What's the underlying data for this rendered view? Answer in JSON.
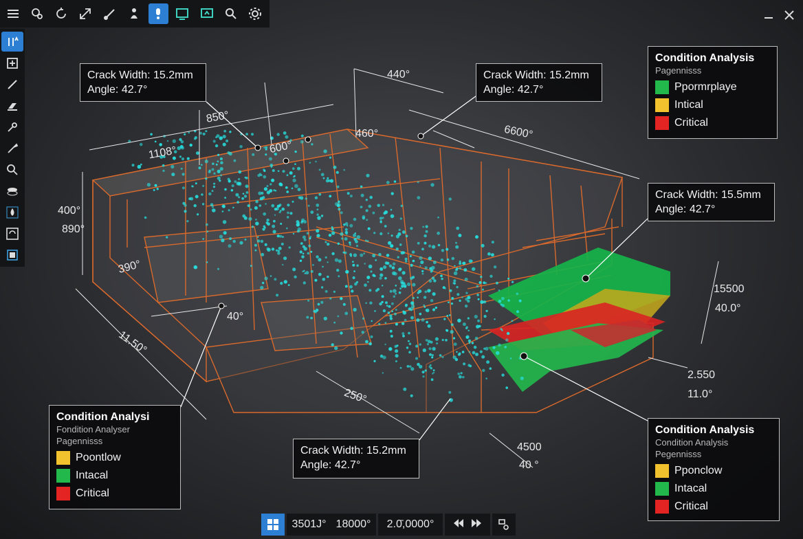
{
  "toolbar": {
    "top": [
      "menu-icon",
      "orbit-icon",
      "rotate-icon",
      "expand-icon",
      "brush-icon",
      "person-icon",
      "probe-icon",
      "screen-icon",
      "screen-share-icon",
      "search-icon",
      "settings-icon"
    ],
    "top_active": "probe-icon",
    "left": [
      "measure-icon",
      "add-icon",
      "pen-icon",
      "eraser-icon",
      "dropper-icon",
      "paint-icon",
      "zoom-icon",
      "layers-icon",
      "droplet-icon",
      "refresh-icon",
      "square-icon"
    ],
    "left_active": "measure-icon"
  },
  "window": {
    "minimize": "minimize-icon",
    "close": "close-icon"
  },
  "callouts": [
    {
      "line1": "Crack Width: 15.2mm",
      "line2": "Angle: 42.7°"
    },
    {
      "line1": "Crack Width: 15.2mm",
      "line2": "Angle: 42.7°"
    },
    {
      "line1": "Crack Width: 15.5mm",
      "line2": "Angle: 42.7°"
    },
    {
      "line1": "Crack Width: 15.2mm",
      "line2": "Angle: 42.7°"
    }
  ],
  "panels": [
    {
      "title": "Condition Analysis",
      "subtitles": [
        "Pagennisss"
      ],
      "items": [
        {
          "label": "Ppormrplaye",
          "color": "#22b84c"
        },
        {
          "label": "Intical",
          "color": "#f2c12e"
        },
        {
          "label": "Critical",
          "color": "#e42323"
        }
      ]
    },
    {
      "title": "Condition Analysi",
      "subtitles": [
        "Fondition Analyser",
        "Pagennisss"
      ],
      "items": [
        {
          "label": "Poontlow",
          "color": "#f2c12e"
        },
        {
          "label": "Intacal",
          "color": "#22b84c"
        },
        {
          "label": "Critical",
          "color": "#e42323"
        }
      ]
    },
    {
      "title": "Condition Analysis",
      "subtitles": [
        "Condition Analysis",
        "Pegennisss"
      ],
      "items": [
        {
          "label": "Pponclow",
          "color": "#f2c12e"
        },
        {
          "label": "Intacal",
          "color": "#22b84c"
        },
        {
          "label": "Critical",
          "color": "#e42323"
        }
      ]
    }
  ],
  "dimensions": [
    "440°",
    "850°",
    "1108°",
    "600°",
    "460°",
    "6600°",
    "400°",
    "890°",
    "390°",
    "40°",
    "11.50°",
    "250°",
    "15500",
    "40.0°",
    "2.550",
    "11.0°",
    "4500",
    "40 °"
  ],
  "bottom": {
    "view_icon": "grid-icon",
    "coords_a": "3501J°",
    "coords_b": "18000°",
    "scale": "2.0̄,0000°",
    "prev_icon": "rewind-icon",
    "next_icon": "forward-icon",
    "export_icon": "export-icon"
  },
  "colors": {
    "accent": "#2d7fd3",
    "frame": "#d9692c",
    "points": "#26e0e0",
    "green": "#22b84c",
    "yellow": "#f2c12e",
    "red": "#e42323"
  }
}
